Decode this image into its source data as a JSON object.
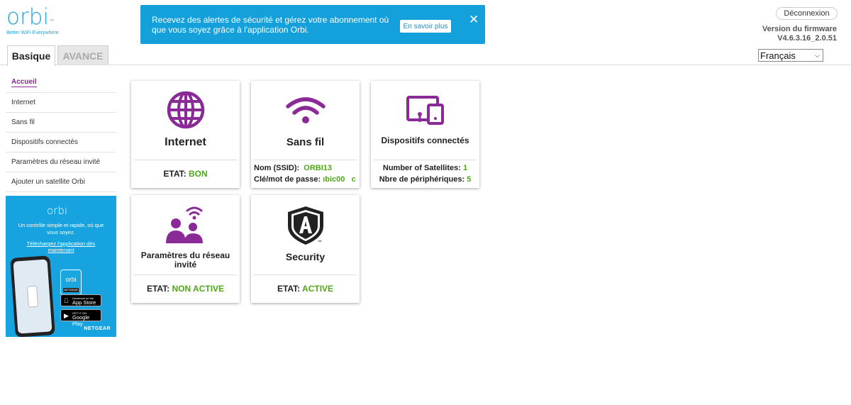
{
  "logo": {
    "word": "orbi",
    "tm": "™",
    "tagline": "Better WiFi Everywhere."
  },
  "banner": {
    "text": "Recevez des alertes de sécurité et gérez votre abonnement où que vous soyez grâce à l'application Orbi.",
    "button_label": "En savoir plus",
    "close_icon": "✕"
  },
  "header": {
    "logout_label": "Déconnexion",
    "firmware_label": "Version du firmware",
    "firmware_version": "V4.6.3.16_2.0.51",
    "language_selected": "Français"
  },
  "tabs": {
    "basic": "Basique",
    "advanced": "AVANCE"
  },
  "sidebar": {
    "items": [
      {
        "label": "Accueil"
      },
      {
        "label": "Internet"
      },
      {
        "label": "Sans fil"
      },
      {
        "label": "Dispositifs connectés"
      },
      {
        "label": "Paramètres du réseau invité"
      },
      {
        "label": "Ajouter un satellite Orbi"
      }
    ]
  },
  "promo": {
    "logo": "orbi",
    "text": "Un contrôle simple et rapide, où que vous soyez.",
    "link": "Téléchargez l'application dès maintenant",
    "app_tile": "orbi",
    "app_tile_label": "NETGEAR",
    "appstore_small": "Download on the",
    "appstore_big": "App Store",
    "googleplay_small": "GET IT ON",
    "googleplay_big": "Google Play",
    "brand": "NETGEAR"
  },
  "cards": {
    "internet": {
      "title": "Internet",
      "status_label": "ETAT:",
      "status_value": "BON"
    },
    "wireless": {
      "title": "Sans fil",
      "ssid_label": "Nom (SSID):",
      "ssid_value": "ORBI13",
      "pass_label": "Clé/mot de passe:",
      "pass_value": "ıbic00   c"
    },
    "devices": {
      "title": "Dispositifs connectés",
      "sat_label": "Number of Satellites:",
      "sat_value": "1",
      "dev_label": "Nbre de périphériques:",
      "dev_value": "5"
    },
    "guest": {
      "title": "Paramètres du réseau invité",
      "status_label": "ETAT:",
      "status_value": "NON ACTIVE"
    },
    "security": {
      "title": "Security",
      "status_label": "ETAT:",
      "status_value": "ACTIVE",
      "tm": "™"
    }
  },
  "colors": {
    "accent": "#8a2a96",
    "brand_blue": "#14a0db",
    "status_green": "#4ea815"
  }
}
